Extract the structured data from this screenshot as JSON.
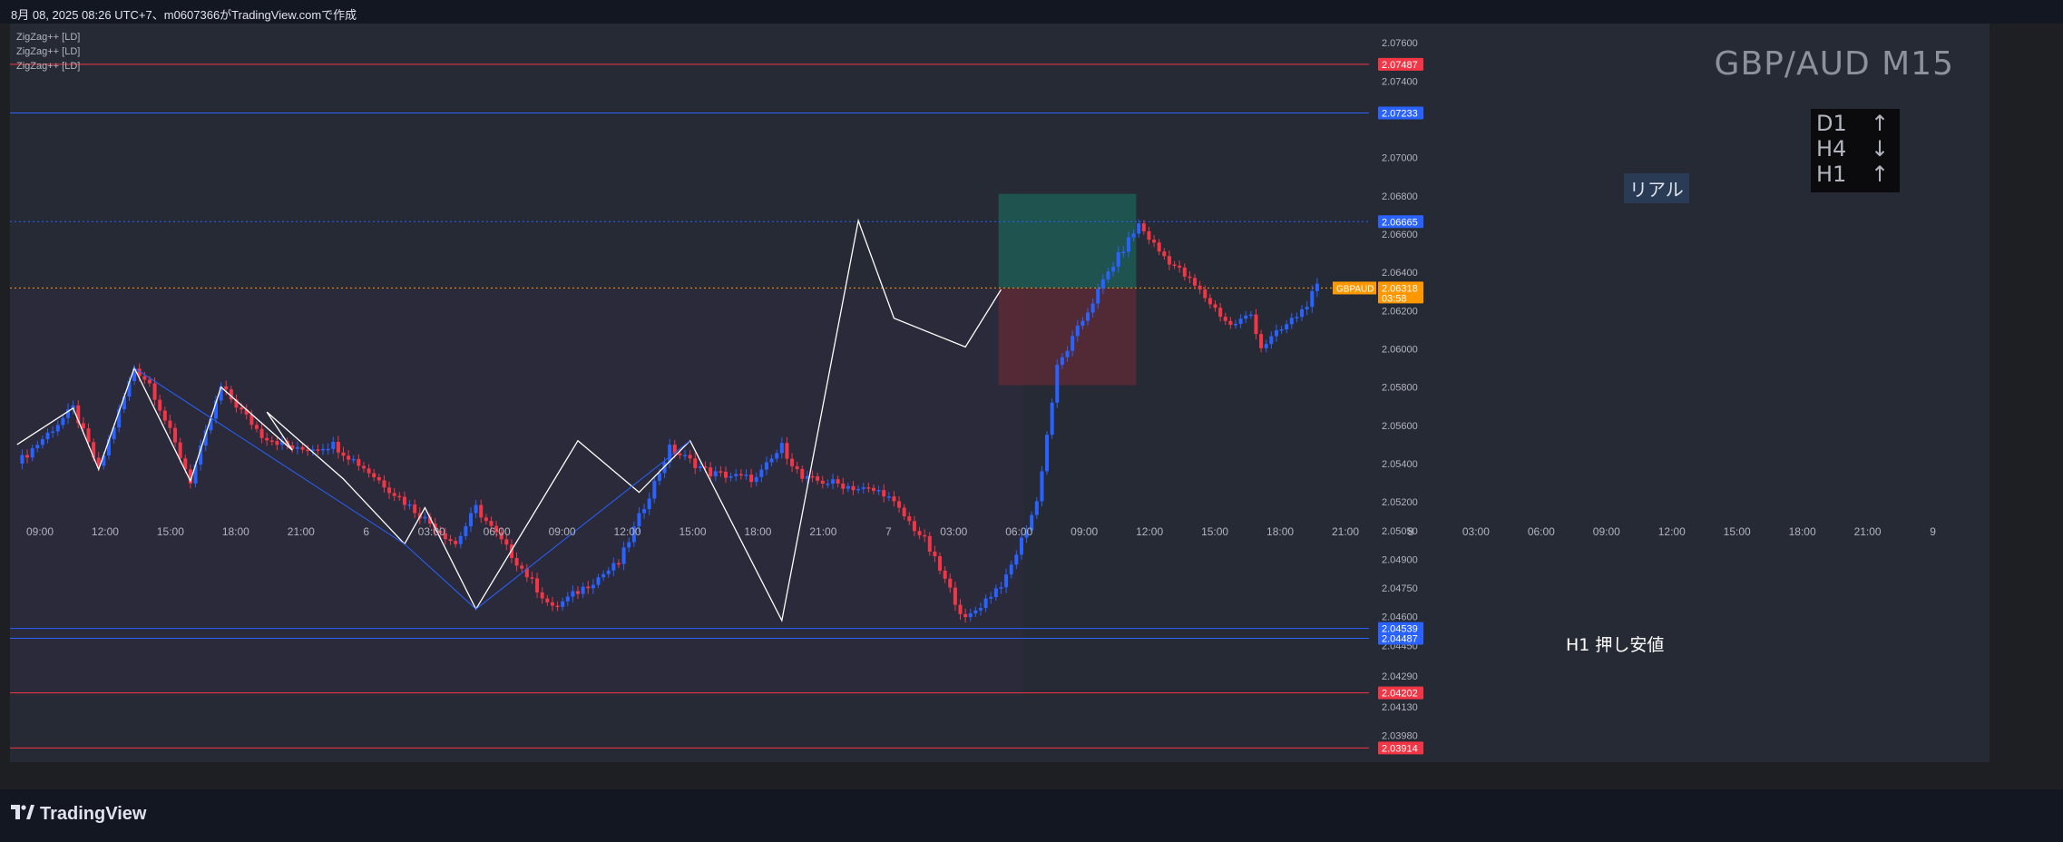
{
  "header": {
    "caption": "8月 08, 2025 08:26 UTC+7、m0607366がTradingView.comで作成"
  },
  "indicators": [
    "ZigZag++ [LD]",
    "ZigZag++ [LD]",
    "ZigZag++ [LD]"
  ],
  "symbol_title": "GBP/AUD M15",
  "timeframe_trend": [
    {
      "tf": "D1",
      "arrow": "↑"
    },
    {
      "tf": "H4",
      "arrow": "↓"
    },
    {
      "tf": "H1",
      "arrow": "↑"
    }
  ],
  "position_label": "リアル",
  "support_label": "H1 押し安値",
  "footer": {
    "brand": "TradingView"
  },
  "colors": {
    "bull": "#2962ff",
    "bear": "#f23645",
    "zigzag": "#ffffff",
    "zigzag2": "#2962ff",
    "red_line": "#f23645",
    "blue_line": "#2962ff",
    "profit": "#1e5a55",
    "loss": "#5a2a35",
    "tag_orange": "#ff9800"
  },
  "chart_data": {
    "type": "candlestick",
    "title": "GBP/AUD M15",
    "ylim": [
      2.0384,
      2.077
    ],
    "y_ticks": [
      "2.07600",
      "2.07400",
      "2.07000",
      "2.06800",
      "2.06600",
      "2.06400",
      "2.06200",
      "2.06000",
      "2.05800",
      "2.05600",
      "2.05400",
      "2.05200",
      "2.05050",
      "2.04900",
      "2.04750",
      "2.04600",
      "2.04450",
      "2.04290",
      "2.04130",
      "2.03980"
    ],
    "x_ticks": [
      "09:00",
      "12:00",
      "15:00",
      "18:00",
      "21:00",
      "6",
      "03:00",
      "06:00",
      "09:00",
      "12:00",
      "15:00",
      "18:00",
      "21:00",
      "7",
      "03:00",
      "06:00",
      "09:00",
      "12:00",
      "15:00",
      "18:00",
      "21:00",
      "8",
      "03:00",
      "06:00",
      "09:00",
      "12:00",
      "15:00",
      "18:00",
      "21:00",
      "9"
    ],
    "price_path": [
      [
        0,
        2.054
      ],
      [
        5,
        2.0553
      ],
      [
        11,
        2.0569
      ],
      [
        16,
        2.0537
      ],
      [
        23,
        2.059
      ],
      [
        26,
        2.0582
      ],
      [
        34,
        2.0531
      ],
      [
        40,
        2.058
      ],
      [
        48,
        2.0555
      ],
      [
        55,
        2.0547
      ],
      [
        62,
        2.055
      ],
      [
        68,
        2.0538
      ],
      [
        76,
        2.052
      ],
      [
        86,
        2.0498
      ],
      [
        90,
        2.0517
      ],
      [
        105,
        2.0464
      ],
      [
        118,
        2.0488
      ],
      [
        128,
        2.0548
      ],
      [
        136,
        2.0535
      ],
      [
        145,
        2.0532
      ],
      [
        150,
        2.0549
      ],
      [
        154,
        2.0532
      ],
      [
        160,
        2.053
      ],
      [
        165,
        2.0527
      ],
      [
        170,
        2.0525
      ],
      [
        178,
        2.05
      ],
      [
        186,
        2.0458
      ],
      [
        194,
        2.048
      ],
      [
        200,
        2.052
      ],
      [
        204,
        2.059
      ],
      [
        208,
        2.061
      ],
      [
        214,
        2.064
      ],
      [
        220,
        2.0665
      ],
      [
        224,
        2.0651
      ],
      [
        228,
        2.0641
      ],
      [
        232,
        2.063
      ],
      [
        238,
        2.0612
      ],
      [
        242,
        2.0618
      ],
      [
        244,
        2.0601
      ],
      [
        248,
        2.061
      ],
      [
        252,
        2.062
      ],
      [
        255,
        2.0632
      ]
    ],
    "zigzag_white": [
      [
        0,
        2.055
      ],
      [
        11,
        2.0569
      ],
      [
        16,
        2.0537
      ],
      [
        23,
        2.059
      ],
      [
        34,
        2.0531
      ],
      [
        40,
        2.058
      ],
      [
        54,
        2.0547
      ],
      [
        49,
        2.0567
      ],
      [
        64,
        2.0532
      ],
      [
        76,
        2.0498
      ],
      [
        80,
        2.0517
      ],
      [
        90,
        2.0464
      ],
      [
        110,
        2.0552
      ],
      [
        122,
        2.0525
      ],
      [
        132,
        2.0552
      ],
      [
        150,
        2.0458
      ],
      [
        165,
        2.0667
      ],
      [
        172,
        2.0616
      ],
      [
        186,
        2.0601
      ],
      [
        193,
        2.0631
      ]
    ],
    "zigzag_blue": [
      [
        23,
        2.059
      ],
      [
        76,
        2.0498
      ],
      [
        90,
        2.0464
      ],
      [
        132,
        2.0552
      ]
    ],
    "levels": [
      {
        "label": "2.07487",
        "value": 2.07487,
        "color": "#f23645",
        "style": "solid"
      },
      {
        "label": "2.07233",
        "value": 2.07233,
        "color": "#2962ff",
        "style": "solid"
      },
      {
        "label": "2.06665",
        "value": 2.06665,
        "color": "#2962ff",
        "style": "dotted"
      },
      {
        "label": "2.06318",
        "value": 2.06318,
        "color": "#ff9800",
        "style": "dotted",
        "symbol": "GBPAUD",
        "countdown": "03:58"
      },
      {
        "label": "2.04539",
        "value": 2.04539,
        "color": "#2962ff",
        "style": "solid"
      },
      {
        "label": "2.04487",
        "value": 2.04487,
        "color": "#2962ff",
        "style": "solid"
      },
      {
        "label": "2.04202",
        "value": 2.04202,
        "color": "#f23645",
        "style": "solid"
      },
      {
        "label": "2.03914",
        "value": 2.03914,
        "color": "#f23645",
        "style": "solid"
      }
    ],
    "position": {
      "entry": 2.06318,
      "target": 2.0681,
      "stop": 2.0581
    },
    "grid": false,
    "legend": "top-left"
  }
}
